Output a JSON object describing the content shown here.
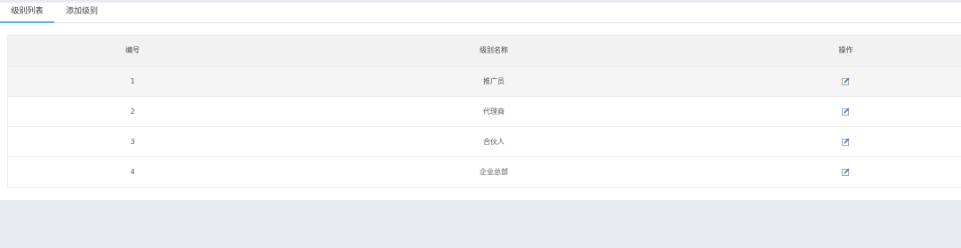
{
  "tabs": [
    {
      "label": "级别列表"
    },
    {
      "label": "添加级别"
    }
  ],
  "table": {
    "headers": {
      "id": "编号",
      "name": "级别名称",
      "operation": "操作"
    },
    "rows": [
      {
        "id": "1",
        "name": "推广员",
        "action_icon": "edit-icon"
      },
      {
        "id": "2",
        "name": "代理商",
        "action_icon": "edit-icon"
      },
      {
        "id": "3",
        "name": "合伙人",
        "action_icon": "edit-icon"
      },
      {
        "id": "4",
        "name": "企业总部",
        "action_icon": "edit-icon"
      }
    ]
  },
  "colors": {
    "active_tab_underline": "#5ab0f0",
    "page_background": "#e8ebef",
    "header_background": "#f2f2f2"
  }
}
